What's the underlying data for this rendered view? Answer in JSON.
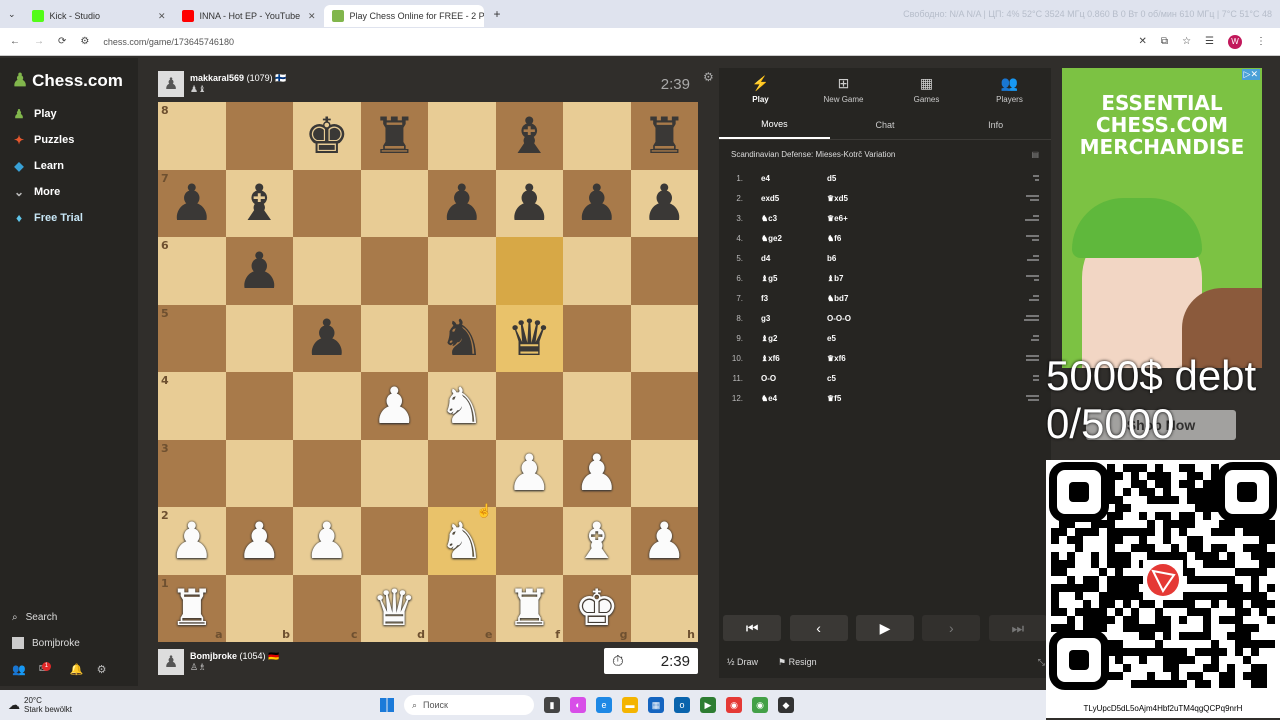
{
  "browser": {
    "tabs": [
      {
        "title": "Kick - Studio",
        "color": "#53fc18"
      },
      {
        "title": "INNA - Hot EP - YouTube",
        "color": "#ff0000"
      },
      {
        "title": "Play Chess Online for FREE - 2 P",
        "color": "#81b64c"
      }
    ],
    "stats_text": "Свободно: N/A N/A | ЦП: 4% 52°C 3524 МГц 0.860 В 0 Вт 0 об/мин 610 МГц | 7°C 51°C 48",
    "url": "chess.com/game/173645746180"
  },
  "sidebar": {
    "logo": "Chess.com",
    "items": [
      {
        "label": "Play",
        "icon": "♟",
        "color": "#81b64c"
      },
      {
        "label": "Puzzles",
        "icon": "✦",
        "color": "#e4572e"
      },
      {
        "label": "Learn",
        "icon": "◆",
        "color": "#38a1d6"
      },
      {
        "label": "More",
        "icon": "⌄",
        "color": "#bbb"
      },
      {
        "label": "Free Trial",
        "icon": "♦",
        "color": "#5ec4e8"
      }
    ],
    "search_label": "Search",
    "user_label": "Bomjbroke",
    "notification_count": "1"
  },
  "game": {
    "top_player": {
      "name": "makkaral569",
      "rating": "(1079)",
      "flag": "🇫🇮",
      "captures": "♟♝",
      "clock": "2:39"
    },
    "bottom_player": {
      "name": "Bomjbroke",
      "rating": "(1054)",
      "flag": "🇩🇪",
      "captures": "♙♗",
      "clock": "2:39"
    },
    "ranks": [
      "8",
      "7",
      "6",
      "5",
      "4",
      "3",
      "2",
      "1"
    ],
    "files": [
      "a",
      "b",
      "c",
      "d",
      "e",
      "f",
      "g",
      "h"
    ],
    "board": [
      [
        "",
        "",
        "bk",
        "br",
        "",
        "bb",
        "",
        "br"
      ],
      [
        "bp",
        "bb",
        "",
        "",
        "bp",
        "bp",
        "bp",
        "bp"
      ],
      [
        "",
        "bp",
        "",
        "",
        "",
        "",
        "",
        ""
      ],
      [
        "",
        "",
        "bp",
        "",
        "bn",
        "bq",
        "",
        ""
      ],
      [
        "",
        "",
        "",
        "wp",
        "wn",
        "",
        "",
        ""
      ],
      [
        "",
        "",
        "",
        "",
        "",
        "wp",
        "wp",
        ""
      ],
      [
        "wp",
        "wp",
        "wp",
        "",
        "wn",
        "",
        "wb",
        "wp"
      ],
      [
        "wr",
        "",
        "",
        "wq",
        "",
        "wr",
        "wk",
        ""
      ]
    ],
    "highlights": [
      "f6",
      "f5",
      "e2"
    ]
  },
  "panel": {
    "top_tabs": [
      {
        "label": "Play",
        "icon": "⚡"
      },
      {
        "label": "New Game",
        "icon": "⊞"
      },
      {
        "label": "Games",
        "icon": "▦"
      },
      {
        "label": "Players",
        "icon": "👥"
      }
    ],
    "sub_tabs": [
      "Moves",
      "Chat",
      "Info"
    ],
    "opening": "Scandinavian Defense: Mieses-Kotrč Variation",
    "moves": [
      {
        "n": "1.",
        "w": "e4",
        "b": "d5"
      },
      {
        "n": "2.",
        "w": "exd5",
        "b": "♛xd5"
      },
      {
        "n": "3.",
        "w": "♞c3",
        "b": "♛e6+"
      },
      {
        "n": "4.",
        "w": "♞ge2",
        "b": "♞f6"
      },
      {
        "n": "5.",
        "w": "d4",
        "b": "b6"
      },
      {
        "n": "6.",
        "w": "♝g5",
        "b": "♝b7"
      },
      {
        "n": "7.",
        "w": "f3",
        "b": "♞bd7"
      },
      {
        "n": "8.",
        "w": "g3",
        "b": "O-O-O"
      },
      {
        "n": "9.",
        "w": "♝g2",
        "b": "e5"
      },
      {
        "n": "10.",
        "w": "♝xf6",
        "b": "♛xf6"
      },
      {
        "n": "11.",
        "w": "O-O",
        "b": "c5"
      },
      {
        "n": "12.",
        "w": "♞e4",
        "b": "♛f5"
      }
    ],
    "draw_label": "Draw",
    "resign_label": "Resign"
  },
  "ad": {
    "headline": "ESSENTIAL CHESS.COM MERCHANDISE",
    "button": "Shop Now"
  },
  "overlay": {
    "line1": "5000$ debt",
    "line2": "0/5000",
    "wallet": "TLyUpcD5dL5oAjm4Hbf2uTM4qgQCPq9nrH"
  },
  "taskbar": {
    "temp": "20°C",
    "weather": "Stark bewölkt",
    "search": "Поиск"
  }
}
